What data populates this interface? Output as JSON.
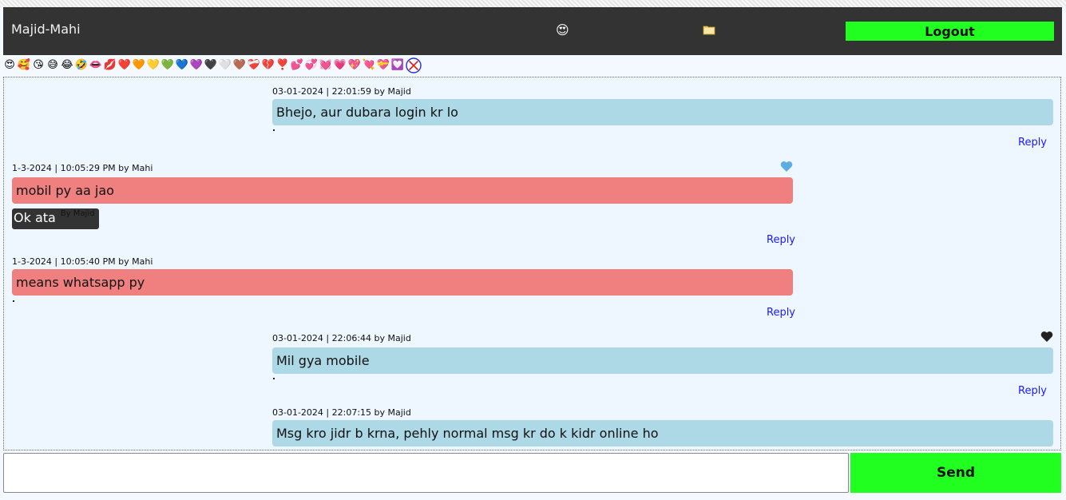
{
  "header": {
    "title": "Majid-Mahi",
    "emoji": "😍",
    "logout_label": "Logout"
  },
  "emoji_bar": [
    "😍",
    "🥰",
    "😘",
    "😅",
    "😂",
    "🤣",
    "👄",
    "💋",
    "❤️",
    "🧡",
    "💛",
    "💚",
    "💙",
    "💜",
    "🖤",
    "🤍",
    "🤎",
    "❤️‍🩹",
    "💔",
    "❣️",
    "💕",
    "💞",
    "💓",
    "💗",
    "💖",
    "💘",
    "💝",
    "💟"
  ],
  "messages": [
    {
      "meta": "03-01-2024 | 22:01:59 by Majid",
      "text": "Bhejo, aur dubara login kr lo",
      "reply_label": "Reply"
    },
    {
      "meta": "1-3-2024 | 10:05:29 PM by Mahi",
      "text": "mobil py aa jao",
      "reaction": "blue-heart",
      "reaction_color": "#5dade2",
      "reply_text": "Ok ata",
      "reply_by": "By Majid",
      "reply_label": "Reply"
    },
    {
      "meta": "1-3-2024 | 10:05:40 PM by Mahi",
      "text": "means whatsapp py",
      "reply_label": "Reply"
    },
    {
      "meta": "03-01-2024 | 22:06:44 by Majid",
      "text": "Mil gya mobile",
      "reaction": "black-heart",
      "reaction_color": "#222222",
      "reply_label": "Reply"
    },
    {
      "meta": "03-01-2024 | 22:07:15 by Majid",
      "text": "Msg kro jidr b krna, pehly normal msg kr do k kidr online ho"
    }
  ],
  "composer": {
    "input_value": "",
    "send_label": "Send"
  },
  "colors": {
    "header_bg": "#333333",
    "accent_green": "#21ff21",
    "bubble_majid": "#add8e6",
    "bubble_mahi": "#f08080",
    "link": "#1a1aff"
  }
}
